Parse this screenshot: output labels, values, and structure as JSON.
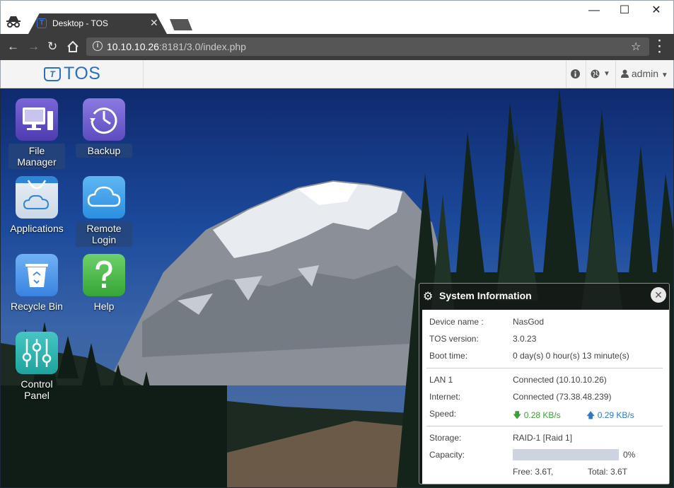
{
  "browser": {
    "tab_title": "Desktop - TOS",
    "url_host": "10.10.10.26",
    "url_rest": ":8181/3.0/index.php"
  },
  "header": {
    "logo": "TOS",
    "logo_badge": "T",
    "user": "admin"
  },
  "apps": [
    {
      "label": "File Manager"
    },
    {
      "label": "Backup"
    },
    {
      "label": "Applications"
    },
    {
      "label": "Remote Login"
    },
    {
      "label": "Recycle Bin"
    },
    {
      "label": "Help"
    },
    {
      "label": "Control Panel"
    }
  ],
  "sysinfo": {
    "title": "System Information",
    "device_name_label": "Device name :",
    "device_name": "NasGod",
    "tos_version_label": "TOS version:",
    "tos_version": "3.0.23",
    "boot_time_label": "Boot time:",
    "boot_time": "0 day(s) 0 hour(s) 13 minute(s)",
    "lan_label": "LAN 1",
    "lan": "Connected (10.10.10.26)",
    "internet_label": "Internet:",
    "internet": "Connected (73.38.48.239)",
    "speed_label": "Speed:",
    "speed_down": "0.28 KB/s",
    "speed_up": "0.29 KB/s",
    "storage_label": "Storage:",
    "storage": "RAID-1 [Raid 1]",
    "capacity_label": "Capacity:",
    "capacity_percent": "0%",
    "capacity_fraction": 0,
    "free": "Free: 3.6T,",
    "total": "Total: 3.6T"
  }
}
